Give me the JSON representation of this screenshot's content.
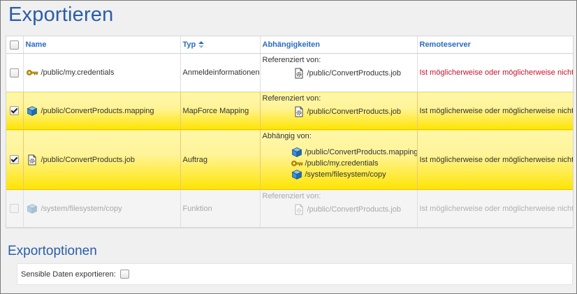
{
  "page": {
    "title": "Exportieren"
  },
  "table": {
    "columns": [
      "Name",
      "Typ",
      "Abhängigkeiten",
      "Remoteserver"
    ],
    "rows": [
      {
        "checked": false,
        "selected": false,
        "disabled": false,
        "icon": "key-icon",
        "name": "/public/my.credentials",
        "type": "Anmeldeinformationen",
        "dep_head": "Referenziert von:",
        "deps": [
          {
            "icon": "job-icon",
            "path": "/public/ConvertProducts.job"
          }
        ],
        "remote": "Ist möglicherweise oder möglicherweise nicht vorhanden"
      },
      {
        "checked": true,
        "selected": true,
        "disabled": false,
        "icon": "mapping-cube-icon",
        "name": "/public/ConvertProducts.mapping",
        "type": "MapForce Mapping",
        "dep_head": "Referenziert von:",
        "deps": [
          {
            "icon": "job-icon",
            "path": "/public/ConvertProducts.job"
          }
        ],
        "remote": "Ist möglicherweise oder möglicherweise nicht vorhanden"
      },
      {
        "checked": true,
        "selected": true,
        "disabled": false,
        "icon": "job-icon",
        "name": "/public/ConvertProducts.job",
        "type": "Auftrag",
        "dep_head": "Abhängig von:",
        "deps": [
          {
            "icon": "mapping-cube-icon",
            "path": "/public/ConvertProducts.mapping"
          },
          {
            "icon": "key-icon",
            "path": "/public/my.credentials"
          },
          {
            "icon": "mapping-cube-icon",
            "path": "/system/filesystem/copy"
          }
        ],
        "remote": "Ist möglicherweise oder möglicherweise nicht vorhanden"
      },
      {
        "checked": false,
        "selected": false,
        "disabled": true,
        "icon": "mapping-cube-icon",
        "name": "/system/filesystem/copy",
        "type": "Funktion",
        "dep_head": "Referenziert von:",
        "deps": [
          {
            "icon": "job-icon",
            "path": "/public/ConvertProducts.job"
          }
        ],
        "remote": "Ist möglicherweise oder möglicherweise nicht vorhanden"
      }
    ]
  },
  "options": {
    "title": "Exportoptionen",
    "sensitive_label": "Sensible Daten exportieren:",
    "sensitive_checked": false
  },
  "colors": {
    "title_blue": "#2a5da8",
    "header_blue": "#2a6cc1",
    "selection_yellow": "#ffe930",
    "remote_red": "#c8102e"
  }
}
